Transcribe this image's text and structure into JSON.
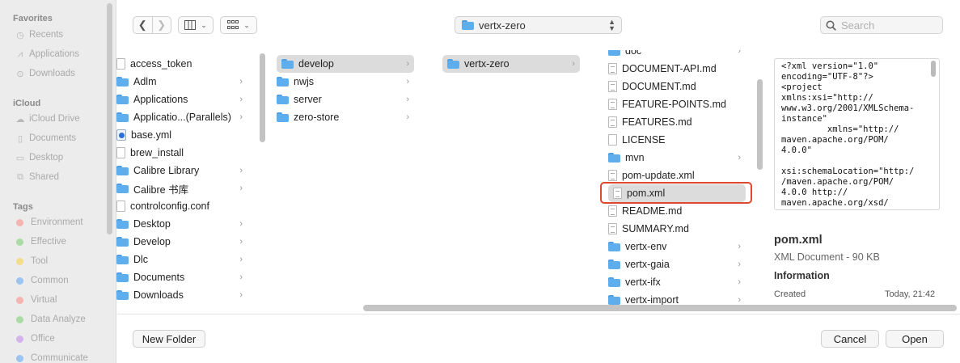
{
  "sidebar": {
    "favorites_header": "Favorites",
    "favorites": [
      {
        "label": "Recents",
        "icon": "clock-icon"
      },
      {
        "label": "Applications",
        "icon": "applications-icon"
      },
      {
        "label": "Downloads",
        "icon": "download-icon"
      }
    ],
    "icloud_header": "iCloud",
    "icloud": [
      {
        "label": "iCloud Drive",
        "icon": "cloud-icon"
      },
      {
        "label": "Documents",
        "icon": "document-icon"
      },
      {
        "label": "Desktop",
        "icon": "desktop-icon"
      },
      {
        "label": "Shared",
        "icon": "shared-folder-icon"
      }
    ],
    "tags_header": "Tags",
    "tags": [
      {
        "label": "Environment",
        "color": "#f6b3b0"
      },
      {
        "label": "Effective",
        "color": "#a9dca4"
      },
      {
        "label": "Tool",
        "color": "#f3dc8a"
      },
      {
        "label": "Common",
        "color": "#9cc4f2"
      },
      {
        "label": "Virtual",
        "color": "#f6b3b0"
      },
      {
        "label": "Data Analyze",
        "color": "#a9dca4"
      },
      {
        "label": "Office",
        "color": "#d5b4ec"
      },
      {
        "label": "Communicate",
        "color": "#9cc4f2"
      }
    ]
  },
  "toolbar": {
    "back_icon": "chevron-left-icon",
    "forward_icon": "chevron-right-icon",
    "view_icon": "columns-view-icon",
    "group_icon": "grid-icon",
    "location": "vertx-zero",
    "search_placeholder": "Search"
  },
  "columns": {
    "col1": [
      {
        "name": "access_token",
        "type": "doc",
        "chevron": false
      },
      {
        "name": "Adlm",
        "type": "folder",
        "chevron": true
      },
      {
        "name": "Applications",
        "type": "folder",
        "chevron": true
      },
      {
        "name": "Applicatio...(Parallels)",
        "type": "folder",
        "chevron": true
      },
      {
        "name": "base.yml",
        "type": "yml",
        "chevron": false
      },
      {
        "name": "brew_install",
        "type": "doc",
        "chevron": false
      },
      {
        "name": "Calibre Library",
        "type": "folder",
        "chevron": true
      },
      {
        "name": "Calibre 书库",
        "type": "folder",
        "chevron": true
      },
      {
        "name": "controlconfig.conf",
        "type": "doc",
        "chevron": false
      },
      {
        "name": "Desktop",
        "type": "folder",
        "chevron": true
      },
      {
        "name": "Develop",
        "type": "folder",
        "chevron": true
      },
      {
        "name": "Dlc",
        "type": "folder",
        "chevron": true
      },
      {
        "name": "Documents",
        "type": "folder",
        "chevron": true
      },
      {
        "name": "Downloads",
        "type": "folder",
        "chevron": true
      }
    ],
    "col2": [
      {
        "name": "develop",
        "type": "folder",
        "chevron": true,
        "selected": true
      },
      {
        "name": "nwjs",
        "type": "folder",
        "chevron": true
      },
      {
        "name": "server",
        "type": "folder",
        "chevron": true
      },
      {
        "name": "zero-store",
        "type": "folder",
        "chevron": true
      }
    ],
    "col3": [
      {
        "name": "vertx-zero",
        "type": "folder",
        "chevron": true,
        "selected": true
      }
    ],
    "col4": [
      {
        "name": "doc",
        "type": "folder",
        "chevron": true
      },
      {
        "name": "DOCUMENT-API.md",
        "type": "doclines",
        "chevron": false
      },
      {
        "name": "DOCUMENT.md",
        "type": "doclines",
        "chevron": false
      },
      {
        "name": "FEATURE-POINTS.md",
        "type": "doclines",
        "chevron": false
      },
      {
        "name": "FEATURES.md",
        "type": "doclines",
        "chevron": false
      },
      {
        "name": "LICENSE",
        "type": "doc",
        "chevron": false
      },
      {
        "name": "mvn",
        "type": "folder",
        "chevron": true
      },
      {
        "name": "pom-update.xml",
        "type": "doclines",
        "chevron": false
      },
      {
        "name": "pom.xml",
        "type": "doclines",
        "chevron": false,
        "selected": true
      },
      {
        "name": "README.md",
        "type": "doclines",
        "chevron": false
      },
      {
        "name": "SUMMARY.md",
        "type": "doclines",
        "chevron": false
      },
      {
        "name": "vertx-env",
        "type": "folder",
        "chevron": true
      },
      {
        "name": "vertx-gaia",
        "type": "folder",
        "chevron": true
      },
      {
        "name": "vertx-ifx",
        "type": "folder",
        "chevron": true
      },
      {
        "name": "vertx-import",
        "type": "folder",
        "chevron": true
      }
    ]
  },
  "preview": {
    "content": "<?xml version=\"1.0\"\nencoding=\"UTF-8\"?>\n<project\nxmlns:xsi=\"http://\nwww.w3.org/2001/XMLSchema-\ninstance\"\n         xmlns=\"http://\nmaven.apache.org/POM/\n4.0.0\"\n\nxsi:schemaLocation=\"http:/\n/maven.apache.org/POM/\n4.0.0 http://\nmaven.apache.org/xsd/",
    "file_name": "pom.xml",
    "kind_size": "XML Document - 90 KB",
    "info_header": "Information",
    "created_label": "Created",
    "created_value": "Today, 21:42"
  },
  "footer": {
    "new_folder": "New Folder",
    "cancel": "Cancel",
    "open": "Open"
  }
}
